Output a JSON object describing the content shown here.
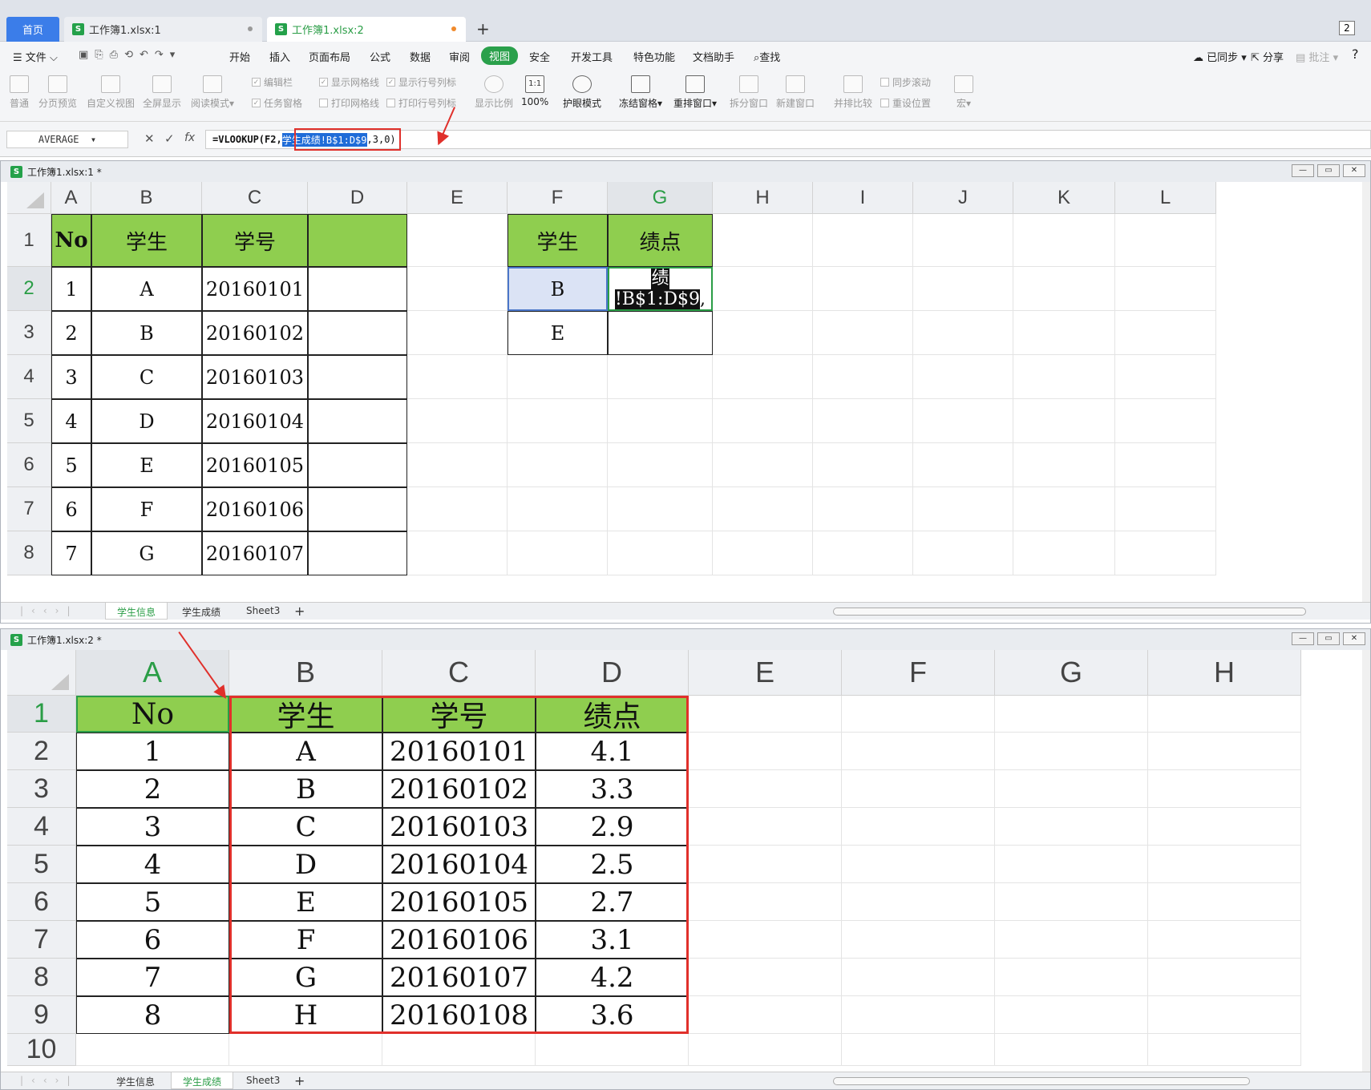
{
  "app_tabs": {
    "home": "首页",
    "book1": "工作簿1.xlsx:1",
    "book2": "工作簿1.xlsx:2",
    "new_tab": "+",
    "badge": "2"
  },
  "menu": {
    "file": "文件",
    "items": [
      "开始",
      "插入",
      "页面布局",
      "公式",
      "数据",
      "审阅",
      "视图",
      "安全",
      "开发工具",
      "特色功能",
      "文档助手"
    ],
    "active": "视图",
    "search": "查找",
    "right": [
      "已同步",
      "分享",
      "批注"
    ],
    "help": "?"
  },
  "ribbon": {
    "big_buttons": [
      "普通",
      "分页预览",
      "自定义视图",
      "全屏显示",
      "阅读模式"
    ],
    "checkboxes": [
      {
        "label": "编辑栏",
        "checked": true
      },
      {
        "label": "任务窗格",
        "checked": false
      },
      {
        "label": "显示网格线",
        "checked": true
      },
      {
        "label": "打印网格线",
        "checked": false
      },
      {
        "label": "显示行号列标",
        "checked": true
      },
      {
        "label": "打印行号列标",
        "checked": false
      }
    ],
    "zoom_buttons": [
      "显示比例",
      "100%"
    ],
    "zoom_icon_text": "1:1",
    "view_buttons": [
      "护眼模式",
      "冻结窗格",
      "重排窗口",
      "拆分窗口",
      "新建窗口"
    ],
    "compare_buttons": [
      "并排比较",
      "同步滚动",
      "重设位置",
      "宏"
    ]
  },
  "formula_bar": {
    "name_box": "AVERAGE",
    "fx": "fx",
    "formula_prefix": "=VLOOKUP(F2,",
    "formula_selected": "学生成绩!B$1:D$9",
    "formula_suffix": ",3,0)"
  },
  "window1": {
    "title": "工作簿1.xlsx:1 *",
    "columns": [
      "A",
      "B",
      "C",
      "D",
      "E",
      "F",
      "G",
      "H",
      "I",
      "J",
      "K",
      "L"
    ],
    "rows": [
      "1",
      "2",
      "3",
      "4",
      "5",
      "6",
      "7",
      "8"
    ],
    "selected_column": "G",
    "selected_row": "2",
    "table_header": [
      "No",
      "学生",
      "学号",
      ""
    ],
    "table_rows": [
      [
        "1",
        "A",
        "20160101",
        ""
      ],
      [
        "2",
        "B",
        "20160102",
        ""
      ],
      [
        "3",
        "C",
        "20160103",
        ""
      ],
      [
        "4",
        "D",
        "20160104",
        ""
      ],
      [
        "5",
        "E",
        "20160105",
        ""
      ],
      [
        "6",
        "F",
        "20160106",
        ""
      ],
      [
        "7",
        "G",
        "20160107",
        ""
      ]
    ],
    "lookup_header": [
      "学生",
      "绩点"
    ],
    "lookup_rows": [
      [
        "B",
        ""
      ],
      [
        "E",
        ""
      ]
    ],
    "editing_cell_line1": "绩",
    "editing_cell_line2": "!B$1:D$9",
    "editing_cell_tail": ",",
    "sheet_tabs": [
      "学生信息",
      "学生成绩",
      "Sheet3"
    ],
    "active_sheet": "学生信息"
  },
  "window2": {
    "title": "工作簿1.xlsx:2 *",
    "columns": [
      "A",
      "B",
      "C",
      "D",
      "E",
      "F",
      "G",
      "H"
    ],
    "rows": [
      "1",
      "2",
      "3",
      "4",
      "5",
      "6",
      "7",
      "8",
      "9",
      "10"
    ],
    "selected_column": "A",
    "selected_row": "1",
    "table_header": [
      "No",
      "学生",
      "学号",
      "绩点"
    ],
    "table_rows": [
      [
        "1",
        "A",
        "20160101",
        "4.1"
      ],
      [
        "2",
        "B",
        "20160102",
        "3.3"
      ],
      [
        "3",
        "C",
        "20160103",
        "2.9"
      ],
      [
        "4",
        "D",
        "20160104",
        "2.5"
      ],
      [
        "5",
        "E",
        "20160105",
        "2.7"
      ],
      [
        "6",
        "F",
        "20160106",
        "3.1"
      ],
      [
        "7",
        "G",
        "20160107",
        "4.2"
      ],
      [
        "8",
        "H",
        "20160108",
        "3.6"
      ]
    ],
    "sheet_tabs": [
      "学生信息",
      "学生成绩",
      "Sheet3"
    ],
    "active_sheet": "学生成绩"
  },
  "colors": {
    "header_green": "#8fce4f",
    "accent": "#2aa04b",
    "highlight_red": "#e0302b",
    "selection_blue": "#1f6cd8"
  }
}
